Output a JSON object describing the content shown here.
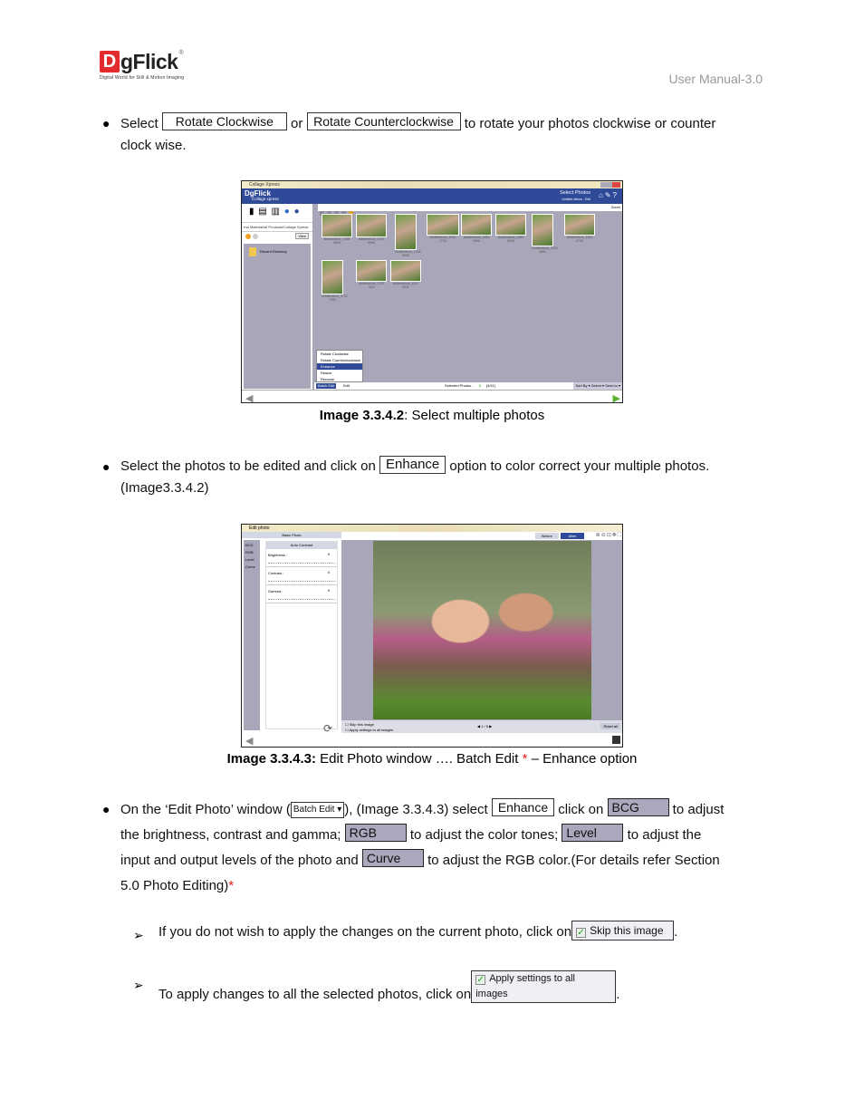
{
  "header": {
    "logo": {
      "mark": "D",
      "name": "gFlick",
      "registered": "®",
      "tagline": "Digital World for Still & Motion Imaging"
    },
    "doc_title": "User Manual-3.0"
  },
  "para1": {
    "prefix": "Select",
    "btn_rotate_cw": "Rotate Clockwise",
    "or": "or",
    "btn_rotate_ccw": "Rotate Counterclockwise",
    "suffix_line1": "to rotate your photos clockwise or counter",
    "suffix_line2": "clock wise."
  },
  "screenshot1": {
    "window_title": "Collage Xpress",
    "brand": "DgFlick",
    "brand_sub": "Collage xpress",
    "page_title": "Select Photos",
    "page_sub": "Untitled album - Edit",
    "path": "rna Material\\all Products\\Collage Xpress",
    "view_label": "View",
    "tree_item": "Recent Directory",
    "zoom_label": "Zoom",
    "thumbnails": [
      "shutterstock_1308 2629",
      "shutterstock_1303 9999",
      "shutterstock_1308 9936",
      "shutterstock_4310 2726",
      "shutterstock_4553 9995",
      "shutterstock_4553 6928",
      "shutterstock_4233 4892",
      "shutterstock_4553 6794",
      "shutterstock_3702 7999",
      "shutterstock_3702 7622",
      "shutterstock_4047 9931"
    ],
    "context_menu": [
      "Rotate Clockwise",
      "Rotate Counterclockwise",
      "Enhance",
      "Resize",
      "Rename"
    ],
    "context_menu_selected": "Enhance",
    "batch_edit": "Batch Edit",
    "edit": "Edit",
    "selected_photos_label": "Selected Photos :",
    "selected_count": "6",
    "selected_ratio": "[4/11]",
    "sort_by": "Sort By",
    "select": "Select",
    "send_to": "Send to"
  },
  "caption1": {
    "label": "Image 3.3.4.2",
    "text": ": Select multiple photos"
  },
  "para2": {
    "prefix": "Select the photos to be edited and click on",
    "btn_enhance": "Enhance",
    "suffix": "option to color correct your multiple photos.",
    "line2": "(Image3.3.4.2)"
  },
  "screenshot2": {
    "window_title": "Edit photo",
    "panel_header": "Basic Photo",
    "tabs": [
      "BCG",
      "RGB",
      "Level",
      "Curve"
    ],
    "auto_contrast": "Auto Contrast",
    "sliders": [
      {
        "label": "Brightness :",
        "value": "0",
        "position": 0.5
      },
      {
        "label": "Contrast :",
        "value": "0",
        "position": 0.5
      },
      {
        "label": "Gamma :",
        "value": "0",
        "position": 0.5
      }
    ],
    "before": "Before",
    "after": "After",
    "skip_image": "Skip this image",
    "apply_all": "Apply settings to all images",
    "pager": "1 / 5",
    "reset_all": "Reset all"
  },
  "caption2": {
    "label": "Image 3.3.4.3:",
    "text": " Edit Photo window …. Batch Edit ",
    "asterisk": "*",
    "text2": " – Enhance option"
  },
  "para3": {
    "p1": "On the ‘Edit Photo’ window (",
    "btn_batch": "Batch Edit ▾",
    "p2": "), (Image 3.3.4.3) select",
    "btn_enhance": "Enhance",
    "p3": "click on",
    "btn_bcg": "BCG",
    "p4": "to adjust",
    "p5": "the brightness, contrast and gamma;",
    "btn_rgb": "RGB",
    "p6": "to adjust the color tones;",
    "btn_level": "Level",
    "p7": "to adjust the",
    "p8": "input and output levels of the photo and",
    "btn_curve": "Curve",
    "p9": "to adjust the RGB color.(For details refer Section",
    "p10": "5.0 Photo Editing)",
    "asterisk": "*"
  },
  "sub1": {
    "text": "If you do not wish to apply the changes on the current photo, click on",
    "btn": "Skip this image",
    "end": "."
  },
  "sub2": {
    "text": "To apply changes to all the selected photos, click on",
    "btn": "Apply settings to all images",
    "end": "."
  }
}
